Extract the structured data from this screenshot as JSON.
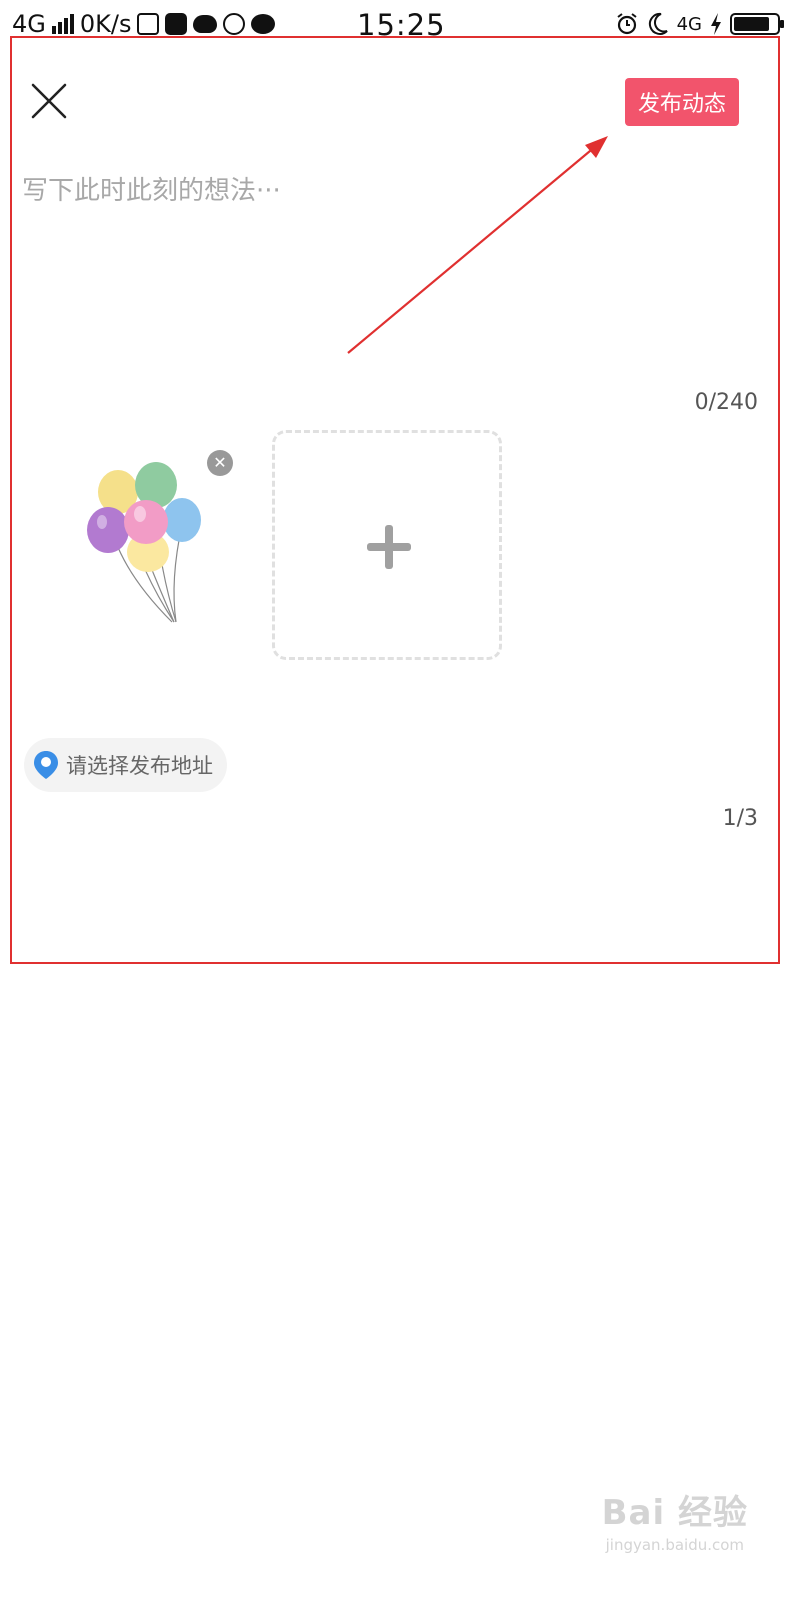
{
  "status_bar": {
    "network": "4G",
    "speed": "0K/s",
    "time": "15:25",
    "network_right": "4G",
    "icons_left": [
      "signal-icon",
      "s-app-icon",
      "mail-icon",
      "cloud-icon",
      "pinwheel-icon",
      "chat-icon"
    ],
    "icons_right": [
      "alarm-icon",
      "moon-icon",
      "charging-icon",
      "battery-icon"
    ]
  },
  "composer": {
    "close_icon": "close-icon",
    "publish_label": "发布动态",
    "placeholder": "写下此时此刻的想法···",
    "char_count": "0/240",
    "add_photo_icon": "plus-icon",
    "location_label": "请选择发布地址",
    "page_count": "1/3"
  },
  "colors": {
    "publish": "#f2546c",
    "annotation": "#e03030",
    "location_pin": "#3a8ee6"
  },
  "watermark": {
    "logo": "Bai 经验",
    "url": "jingyan.baidu.com"
  }
}
